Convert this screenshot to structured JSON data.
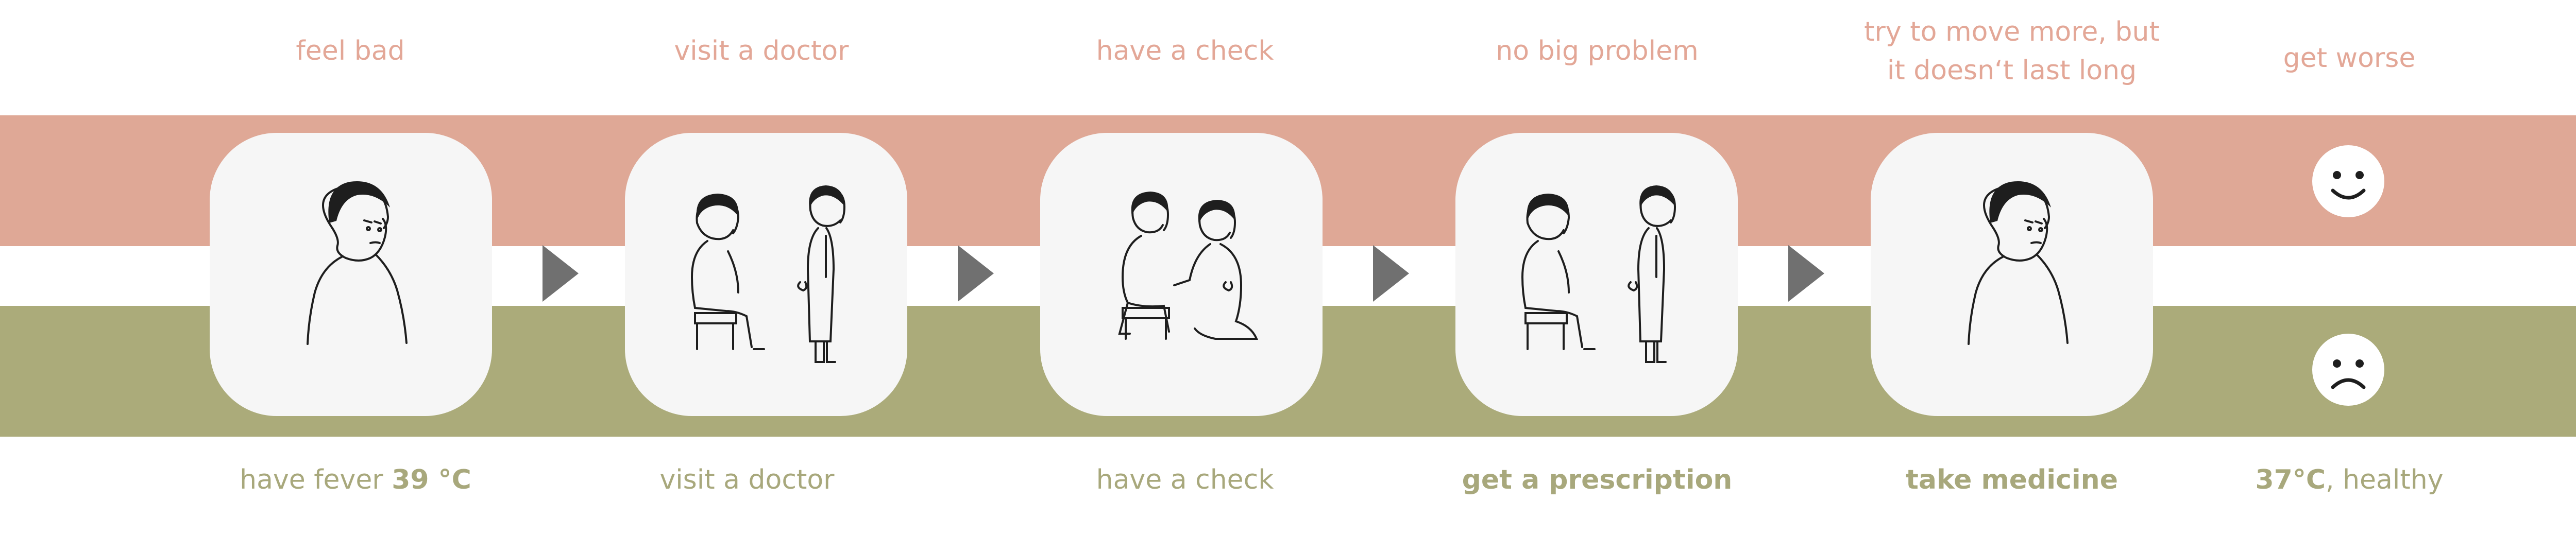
{
  "colors": {
    "top_band": "#dfa896",
    "bottom_band": "#abab7a",
    "top_text": "#e3a797",
    "bottom_text": "#a8a87c",
    "arrow": "#707070",
    "card": "#f6f6f6",
    "ink": "#1e1e1e"
  },
  "top_labels": [
    {
      "line1": "feel bad",
      "line2": ""
    },
    {
      "line1": "visit a doctor",
      "line2": ""
    },
    {
      "line1": "have a check",
      "line2": ""
    },
    {
      "line1": "no big problem",
      "line2": ""
    },
    {
      "line1": "try to move more, but",
      "line2": "it doesn‘t last long"
    },
    {
      "line1": "get worse",
      "line2": ""
    }
  ],
  "bottom_labels": [
    {
      "pre": "have fever ",
      "bold": "39 °C",
      "post": ""
    },
    {
      "pre": "visit a doctor",
      "bold": "",
      "post": ""
    },
    {
      "pre": "have a check",
      "bold": "",
      "post": ""
    },
    {
      "pre": "",
      "bold": "get a prescription",
      "post": ""
    },
    {
      "pre": "",
      "bold": "take medicine",
      "post": ""
    },
    {
      "pre": "",
      "bold": "37°C",
      "post": ", healthy"
    }
  ],
  "cards": [
    {
      "icon": "sad-person-icon"
    },
    {
      "icon": "patient-doctor-icon"
    },
    {
      "icon": "doctor-examining-icon"
    },
    {
      "icon": "patient-doctor-icon"
    },
    {
      "icon": "sad-person-icon"
    }
  ],
  "faces": {
    "top": "smiley-face-icon",
    "bottom": "sad-face-icon"
  }
}
